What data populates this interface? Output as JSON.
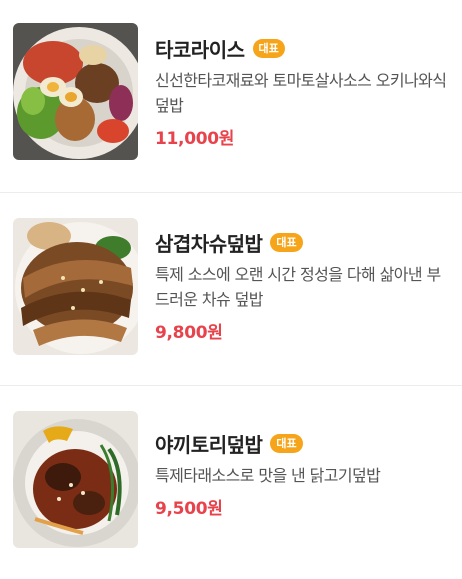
{
  "menu": {
    "items": [
      {
        "name": "타코라이스",
        "badge": "대표",
        "description": "신선한타코재료와 토마토살사소스 오키나와식 덮밥",
        "price": "11,000원",
        "image_icon": "taco-rice-photo"
      },
      {
        "name": "삼겹차슈덮밥",
        "badge": "대표",
        "description": "특제 소스에 오랜 시간 정성을 다해 삶아낸 부드러운 차슈 덮밥",
        "price": "9,800원",
        "image_icon": "chashu-bowl-photo"
      },
      {
        "name": "야끼토리덮밥",
        "badge": "대표",
        "description": "특제타래소스로 맛을 낸 닭고기덮밥",
        "price": "9,500원",
        "image_icon": "yakitori-bowl-photo"
      }
    ],
    "colors": {
      "badge": "#f6a419",
      "price": "#e8434c",
      "divider": "#ececec"
    }
  }
}
